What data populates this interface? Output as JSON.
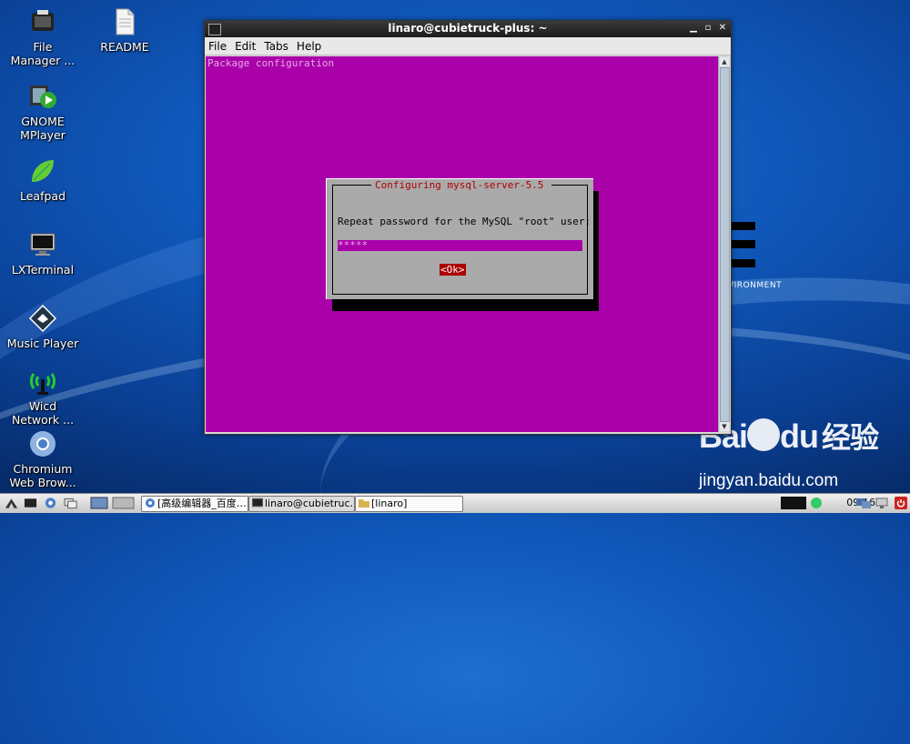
{
  "desktop": {
    "icons": [
      {
        "label": "File\nManager ..."
      },
      {
        "label": "README"
      },
      {
        "label": "GNOME\nMPlayer"
      },
      {
        "label": "Leafpad"
      },
      {
        "label": "LXTerminal"
      },
      {
        "label": "Music Player"
      },
      {
        "label": "Wicd\nNetwork ..."
      },
      {
        "label": "Chromium\nWeb Brow..."
      }
    ],
    "wallpaper_text": "VIRONMENT"
  },
  "watermark": {
    "brand": "Bai",
    "brand2": "du",
    "brand_cn": "经验",
    "url": "jingyan.baidu.com"
  },
  "window": {
    "title": "linaro@cubietruck-plus: ~",
    "menu": [
      "File",
      "Edit",
      "Tabs",
      "Help"
    ],
    "terminal_header": "Package configuration",
    "dialog": {
      "title": "Configuring mysql-server-5.5",
      "prompt": "Repeat password for the MySQL \"root\" user:",
      "password_value": "*****",
      "ok_label": "<Ok>"
    }
  },
  "taskbar": {
    "tasks": [
      {
        "label": "[高级编辑器_百度…"
      },
      {
        "label": "linaro@cubietruc…"
      },
      {
        "label": "[linaro]"
      }
    ],
    "clock": "09:16"
  },
  "colors": {
    "terminal_bg": "#aa00aa",
    "dialog_bg": "#aaaaaa",
    "dialog_title": "#b00000",
    "ok_button": "#aa0000"
  }
}
